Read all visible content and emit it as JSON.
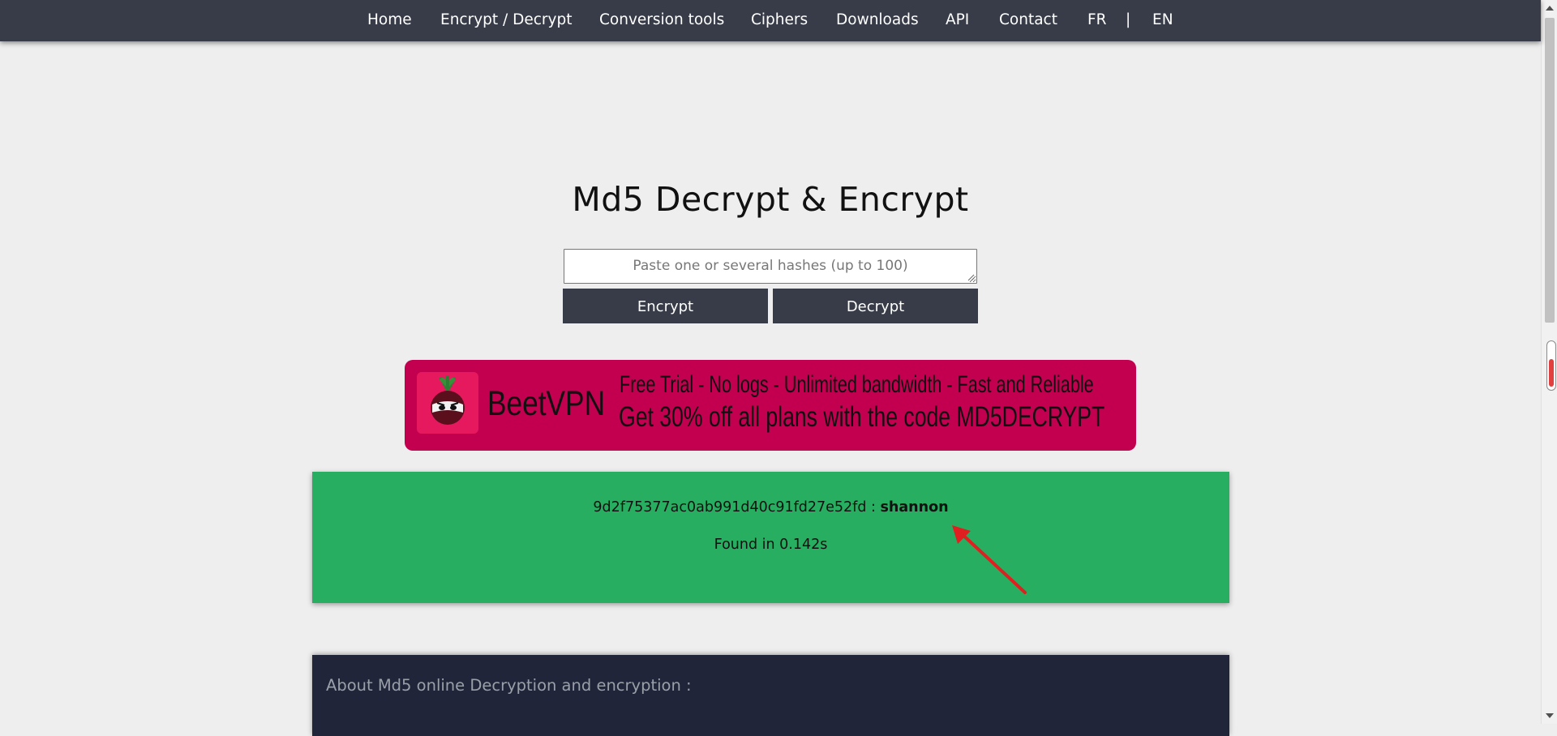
{
  "nav": {
    "items": [
      {
        "id": "home",
        "label": "Home"
      },
      {
        "id": "encrypt-decrypt",
        "label": "Encrypt / Decrypt"
      },
      {
        "id": "conversion-tools",
        "label": "Conversion tools"
      },
      {
        "id": "ciphers",
        "label": "Ciphers"
      },
      {
        "id": "downloads",
        "label": "Downloads"
      },
      {
        "id": "api",
        "label": "API"
      },
      {
        "id": "contact",
        "label": "Contact"
      },
      {
        "id": "fr",
        "label": "FR"
      },
      {
        "id": "separator",
        "label": "|"
      },
      {
        "id": "en",
        "label": "EN"
      }
    ]
  },
  "page": {
    "title": "Md5 Decrypt & Encrypt"
  },
  "form": {
    "placeholder": "Paste one or several hashes (up to 100)",
    "value": "",
    "encrypt_label": "Encrypt",
    "decrypt_label": "Decrypt"
  },
  "ad": {
    "brand": "BeetVPN",
    "line1": "Free Trial - No logs - Unlimited bandwidth - Fast and Reliable",
    "line2": "Get 30% off all plans with the code MD5DECRYPT",
    "logo_icon": "beet-ninja-icon",
    "background": "#c2004f"
  },
  "result": {
    "hash": "9d2f75377ac0ab991d40c91fd27e52fd",
    "separator": " : ",
    "word": "shannon",
    "time": "Found in 0.142s",
    "background": "#27ae60",
    "annotation_icon": "red-arrow-icon"
  },
  "about": {
    "heading": "About Md5 online Decryption and encryption :"
  },
  "colors": {
    "nav_bg": "#373c48",
    "page_bg": "#eeeeee",
    "button_bg": "#373c48",
    "about_bg": "#21253a"
  }
}
